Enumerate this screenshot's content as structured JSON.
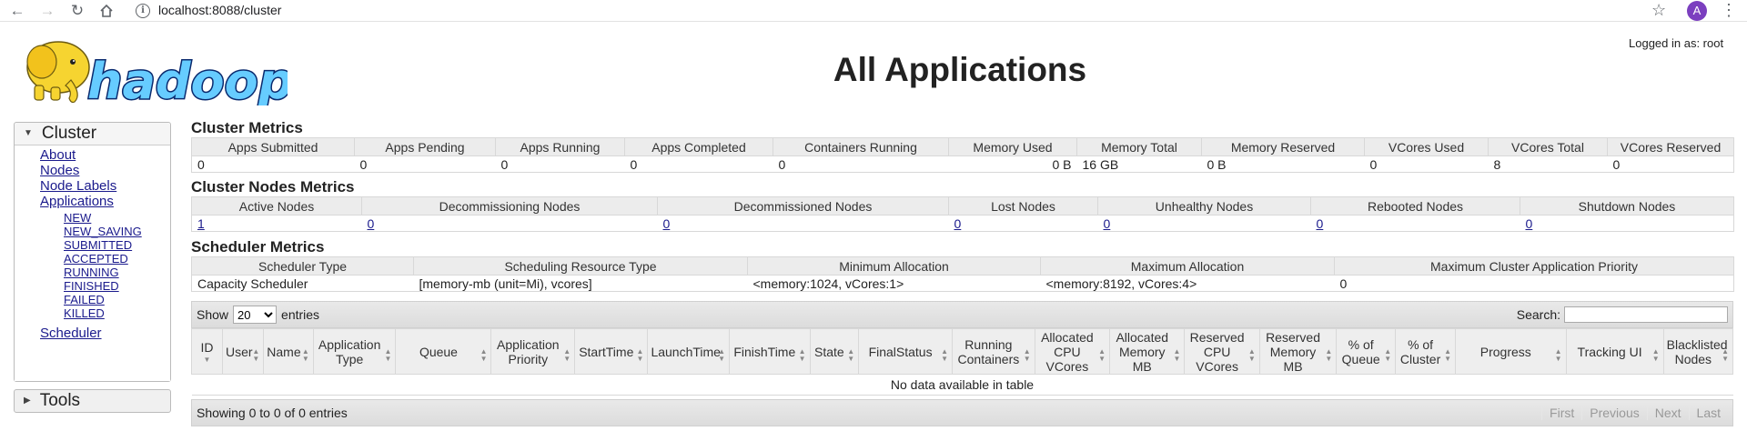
{
  "browser": {
    "url": "localhost:8088/cluster",
    "avatar_letter": "A"
  },
  "header": {
    "logo_text": "hadoop",
    "title": "All Applications",
    "logged_in": "Logged in as: root"
  },
  "sidebar": {
    "cluster_label": "Cluster",
    "links": [
      "About",
      "Nodes",
      "Node Labels",
      "Applications"
    ],
    "app_states": [
      "NEW",
      "NEW_SAVING",
      "SUBMITTED",
      "ACCEPTED",
      "RUNNING",
      "FINISHED",
      "FAILED",
      "KILLED"
    ],
    "scheduler_label": "Scheduler",
    "tools_label": "Tools"
  },
  "cluster_metrics": {
    "title": "Cluster Metrics",
    "headers": [
      "Apps Submitted",
      "Apps Pending",
      "Apps Running",
      "Apps Completed",
      "Containers Running",
      "Memory Used",
      "Memory Total",
      "Memory Reserved",
      "VCores Used",
      "VCores Total",
      "VCores Reserved"
    ],
    "values": [
      "0",
      "0",
      "0",
      "0",
      "0",
      "0 B",
      "16 GB",
      "0 B",
      "0",
      "8",
      "0"
    ]
  },
  "cluster_nodes_metrics": {
    "title": "Cluster Nodes Metrics",
    "headers": [
      "Active Nodes",
      "Decommissioning Nodes",
      "Decommissioned Nodes",
      "Lost Nodes",
      "Unhealthy Nodes",
      "Rebooted Nodes",
      "Shutdown Nodes"
    ],
    "values": [
      "1",
      "0",
      "0",
      "0",
      "0",
      "0",
      "0"
    ]
  },
  "scheduler_metrics": {
    "title": "Scheduler Metrics",
    "headers": [
      "Scheduler Type",
      "Scheduling Resource Type",
      "Minimum Allocation",
      "Maximum Allocation",
      "Maximum Cluster Application Priority"
    ],
    "values": [
      "Capacity Scheduler",
      "[memory-mb (unit=Mi), vcores]",
      "<memory:1024, vCores:1>",
      "<memory:8192, vCores:4>",
      "0"
    ]
  },
  "apps_table": {
    "show_label": "Show",
    "entries_value": "20",
    "entries_label": "entries",
    "search_label": "Search:",
    "columns": [
      [
        "ID"
      ],
      [
        "User"
      ],
      [
        "Name"
      ],
      [
        "Application",
        "Type"
      ],
      [
        "Queue"
      ],
      [
        "Application",
        "Priority"
      ],
      [
        "StartTime"
      ],
      [
        "LaunchTime"
      ],
      [
        "FinishTime"
      ],
      [
        "State"
      ],
      [
        "FinalStatus"
      ],
      [
        "Running",
        "Containers"
      ],
      [
        "Allocated",
        "CPU",
        "VCores"
      ],
      [
        "Allocated",
        "Memory",
        "MB"
      ],
      [
        "Reserved",
        "CPU",
        "VCores"
      ],
      [
        "Reserved",
        "Memory",
        "MB"
      ],
      [
        "% of",
        "Queue"
      ],
      [
        "% of",
        "Cluster"
      ],
      [
        "Progress"
      ],
      [
        "Tracking UI"
      ],
      [
        "Blacklisted",
        "Nodes"
      ]
    ],
    "empty_message": "No data available in table",
    "info": "Showing 0 to 0 of 0 entries",
    "pager": [
      "First",
      "Previous",
      "Next",
      "Last"
    ]
  }
}
